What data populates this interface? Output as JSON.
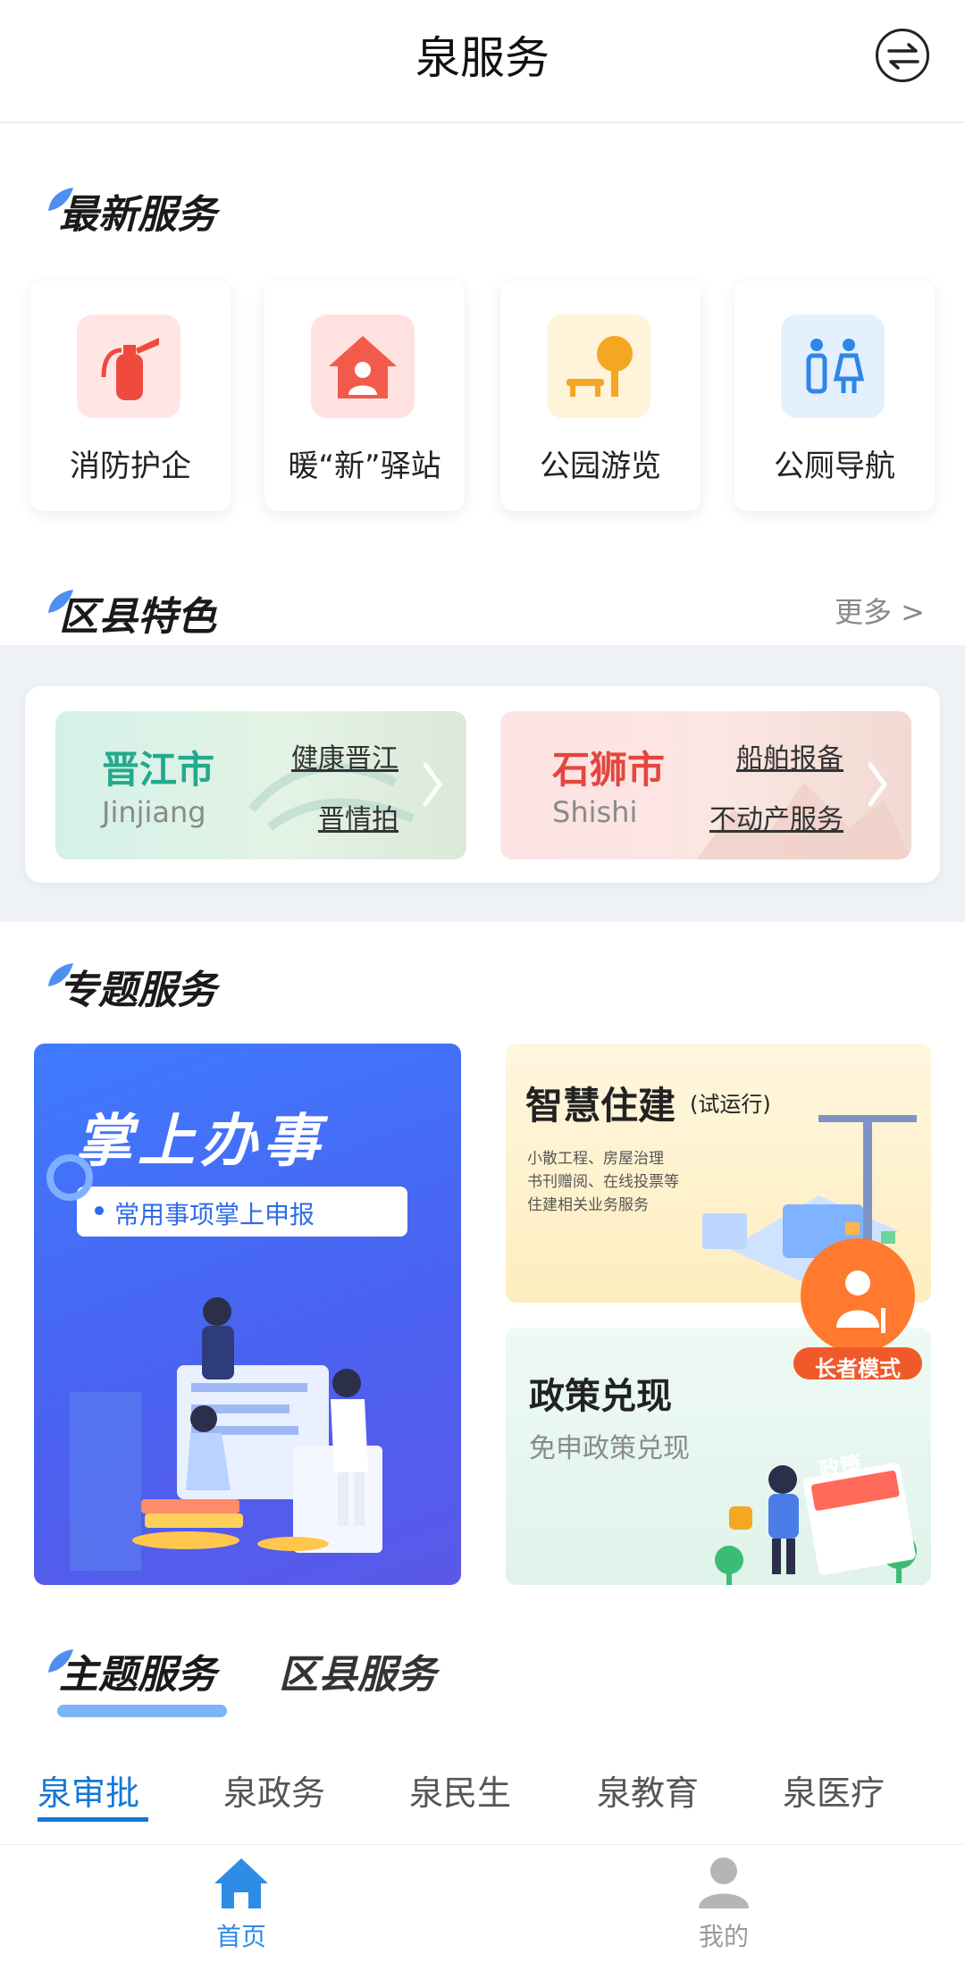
{
  "header": {
    "title": "泉服务",
    "switch_icon": "switch-arrows-icon"
  },
  "latest": {
    "title": "最新服务",
    "items": [
      {
        "label": "消防护企",
        "icon": "fire-extinguisher-icon",
        "color": "#f04a3e",
        "bg": "#ffe6e4"
      },
      {
        "label": "暖“新”驿站",
        "icon": "house-person-icon",
        "color": "#f25a4c",
        "bg": "#ffe2df"
      },
      {
        "label": "公园游览",
        "icon": "park-bench-tree-icon",
        "color": "#f5a623",
        "bg": "#fff3d9"
      },
      {
        "label": "公厕导航",
        "icon": "restroom-icon",
        "color": "#2f86e8",
        "bg": "#e4f0fd"
      }
    ]
  },
  "district": {
    "title": "区县特色",
    "more": "更多 >",
    "items": [
      {
        "name": "晋江市",
        "en": "Jinjiang",
        "links": [
          "健康晋江",
          "晋情拍"
        ],
        "color": "#23a98c"
      },
      {
        "name": "石狮市",
        "en": "Shishi",
        "links": [
          "船舶报备",
          "不动产服务"
        ],
        "color": "#e4463f"
      }
    ]
  },
  "topic": {
    "title": "专题服务",
    "big": {
      "title": "掌上办事",
      "sub": "常用事项掌上申报"
    },
    "r1": {
      "title": "智慧住建",
      "tag": "(试运行)",
      "desc1": "小散工程、房屋治理",
      "desc2": "书刊赠阅、在线投票等",
      "desc3": "住建相关业务服务"
    },
    "r2": {
      "title": "政策兑现",
      "sub": "免申政策兑现",
      "sticker": "政策"
    },
    "elder": "长者模式"
  },
  "tabs": {
    "main": [
      "主题服务",
      "区县服务"
    ],
    "sub": [
      "泉审批",
      "泉政务",
      "泉民生",
      "泉教育",
      "泉医疗"
    ]
  },
  "nav": {
    "items": [
      {
        "label": "首页",
        "icon": "home-icon",
        "active": true
      },
      {
        "label": "我的",
        "icon": "user-icon",
        "active": false
      }
    ]
  },
  "colors": {
    "accent": "#1677d6",
    "nav_active": "#2e8be6",
    "nav_inactive": "#b5b5b5"
  }
}
